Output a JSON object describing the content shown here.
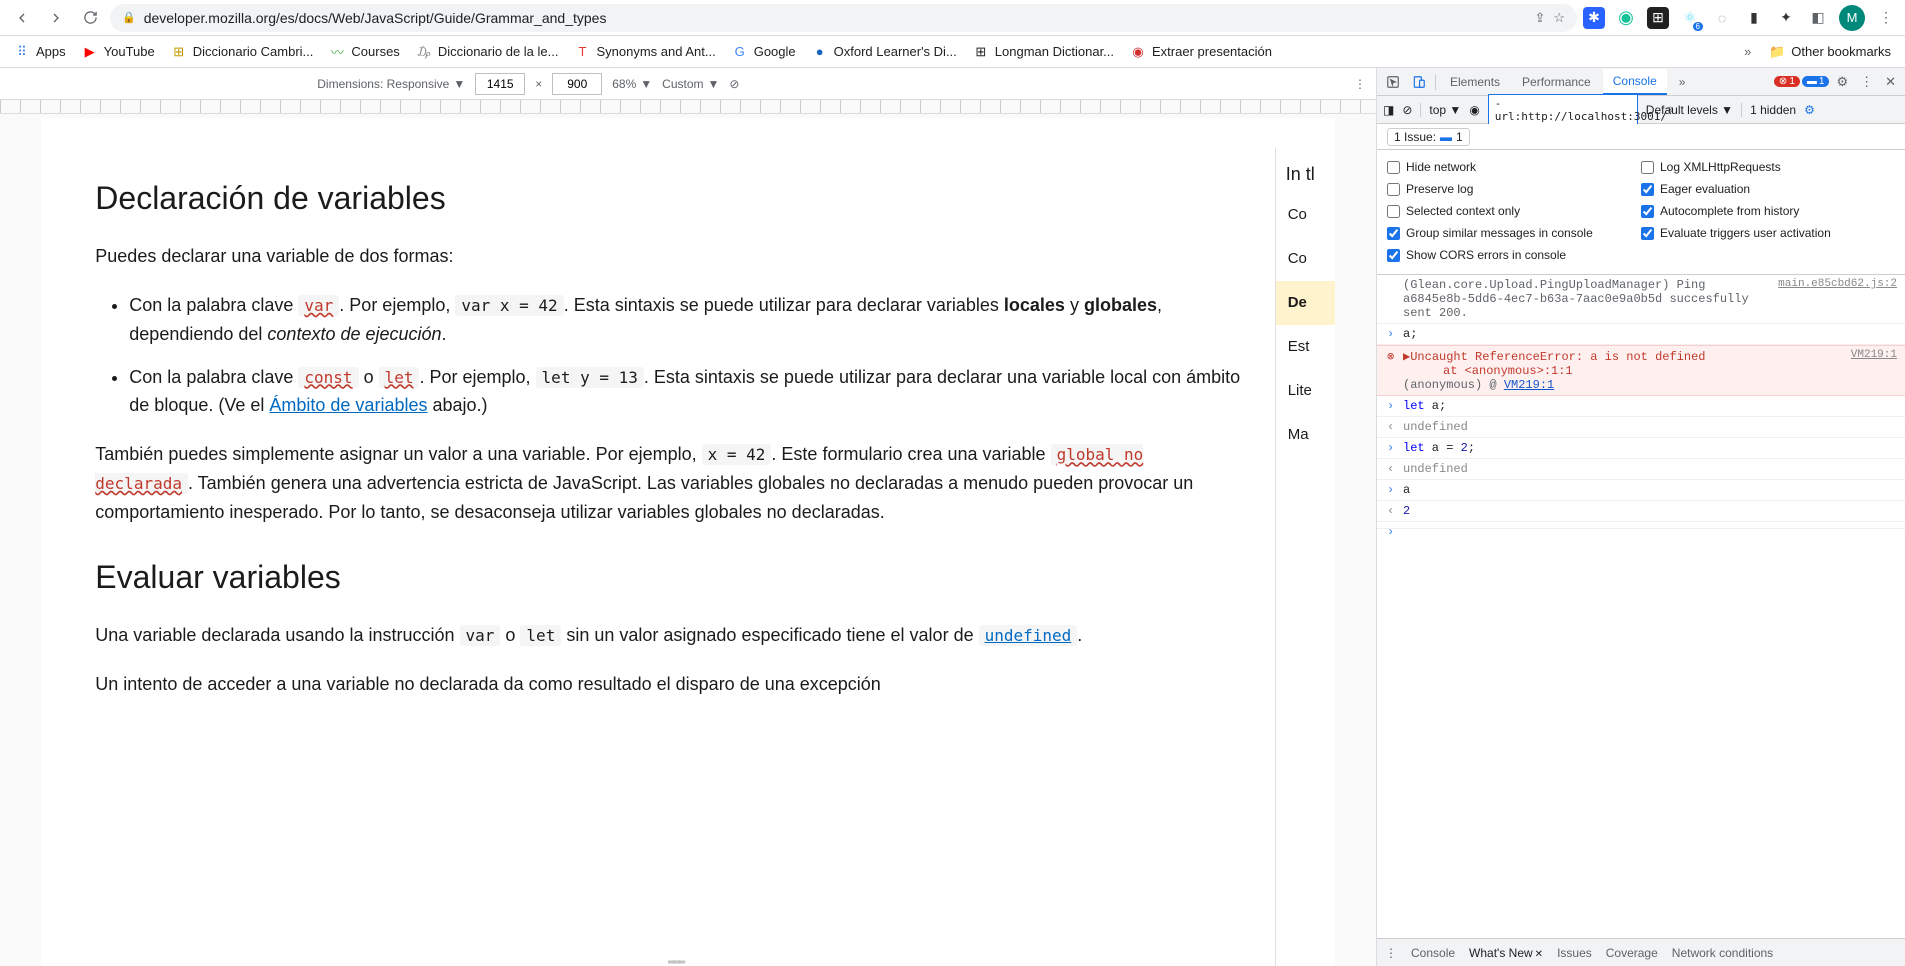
{
  "browser": {
    "url": "developer.mozilla.org/es/docs/Web/JavaScript/Guide/Grammar_and_types",
    "avatar_letter": "M"
  },
  "bookmarks": [
    {
      "icon": "⠿",
      "label": "Apps",
      "color": "#4285f4"
    },
    {
      "icon": "▶",
      "label": "YouTube",
      "color": "#ff0000"
    },
    {
      "icon": "⊞",
      "label": "Diccionario Cambri...",
      "color": "#c19a00"
    },
    {
      "icon": "〰",
      "label": "Courses",
      "color": "#4caf50"
    },
    {
      "icon": "₯",
      "label": "Diccionario de la le...",
      "color": "#888"
    },
    {
      "icon": "T",
      "label": "Synonyms and Ant...",
      "color": "#e53935"
    },
    {
      "icon": "G",
      "label": "Google",
      "color": "#4285f4"
    },
    {
      "icon": "●",
      "label": "Oxford Learner's Di...",
      "color": "#1565c0"
    },
    {
      "icon": "⊞",
      "label": "Longman Dictionar...",
      "color": "#212121"
    },
    {
      "icon": "◉",
      "label": "Extraer presentación",
      "color": "#d32f2f"
    }
  ],
  "bookmarks_more": "»",
  "other_bookmarks": "Other bookmarks",
  "device_toolbar": {
    "dimensions_label": "Dimensions: Responsive",
    "width": "1415",
    "height": "900",
    "x": "×",
    "zoom": "68%",
    "throttle": "Custom"
  },
  "article": {
    "h2_1": "Declaración de variables",
    "p1": "Puedes declarar una variable de dos formas:",
    "li1_a": "Con la palabra clave ",
    "li1_var": "var",
    "li1_b": ". Por ejemplo, ",
    "li1_code": "var x = 42",
    "li1_c": ". Esta sintaxis se puede utilizar para declarar variables ",
    "li1_locales": "locales",
    "li1_y": " y ",
    "li1_globales": "globales",
    "li1_d": ", dependiendo del ",
    "li1_ctx": "contexto de ejecución",
    "li1_e": ".",
    "li2_a": "Con la palabra clave ",
    "li2_const": "const",
    "li2_o": " o ",
    "li2_let": "let",
    "li2_b": ". Por ejemplo, ",
    "li2_code": "let y = 13",
    "li2_c": ". Esta sintaxis se puede utilizar para declarar una variable local con ámbito de bloque. (Ve el ",
    "li2_link": "Ámbito de variables",
    "li2_d": " abajo.)",
    "p2_a": "También puedes simplemente asignar un valor a una variable. Por ejemplo, ",
    "p2_code": "x = 42",
    "p2_b": ". Este formulario crea una variable ",
    "p2_glob": "global no declarada",
    "p2_c": ". También genera una advertencia estricta de JavaScript. Las variables globales no declaradas a menudo pueden provocar un comportamiento inesperado. Por lo tanto, se desaconseja utilizar variables globales no declaradas.",
    "h2_2": "Evaluar variables",
    "p3_a": "Una variable declarada usando la instrucción ",
    "p3_var": "var",
    "p3_o": " o ",
    "p3_let": "let",
    "p3_b": " sin un valor asignado especificado tiene el valor de ",
    "p3_undef": "undefined",
    "p3_c": ".",
    "p4": "Un intento de acceder a una variable no declarada da como resultado el disparo de una excepción"
  },
  "toc": {
    "header": "In tl",
    "items": [
      "Co",
      "Co",
      "De",
      "Est",
      "Lite",
      "Ma"
    ],
    "active_index": 2
  },
  "devtools": {
    "tabs": {
      "elements": "Elements",
      "performance": "Performance",
      "console": "Console",
      "more": "»"
    },
    "error_count": "1",
    "issue_count": "1",
    "subbar": {
      "top": "top",
      "filter": "-url:http://localhost:3001/",
      "levels": "Default levels",
      "hidden": "1 hidden"
    },
    "issues_row": {
      "label": "1 Issue:",
      "count": "1"
    },
    "settings": {
      "hide_network": {
        "label": "Hide network",
        "checked": false
      },
      "log_xhr": {
        "label": "Log XMLHttpRequests",
        "checked": false
      },
      "preserve_log": {
        "label": "Preserve log",
        "checked": false
      },
      "eager_eval": {
        "label": "Eager evaluation",
        "checked": true
      },
      "selected_ctx": {
        "label": "Selected context only",
        "checked": false
      },
      "autocomplete": {
        "label": "Autocomplete from history",
        "checked": true
      },
      "group_similar": {
        "label": "Group similar messages in console",
        "checked": true
      },
      "eval_triggers": {
        "label": "Evaluate triggers user activation",
        "checked": true
      },
      "cors": {
        "label": "Show CORS errors in console",
        "checked": true
      }
    },
    "log": {
      "info_a": "(Glean.core.Upload.PingUploadManager) Ping a6845e8b-5dd6-4ec7-b63a-7aac0e9a0b5d succesfully sent 200.",
      "info_src": "main.e85cbd62.js:2",
      "in1": "a;",
      "err_a": "▶Uncaught ReferenceError: a is not defined",
      "err_b": "at <anonymous>:1:1",
      "err_c": "(anonymous) @ ",
      "err_link": "VM219:1",
      "err_src": "VM219:1",
      "in2_a": "let",
      "in2_b": " a;",
      "out2": "undefined",
      "in3_a": "let",
      "in3_b": " a = ",
      "in3_c": "2",
      "in3_d": ";",
      "out3": "undefined",
      "in4": "a",
      "out4": "2"
    },
    "footer": {
      "console": "Console",
      "whatsnew": "What's New",
      "issues": "Issues",
      "coverage": "Coverage",
      "network": "Network conditions"
    }
  }
}
